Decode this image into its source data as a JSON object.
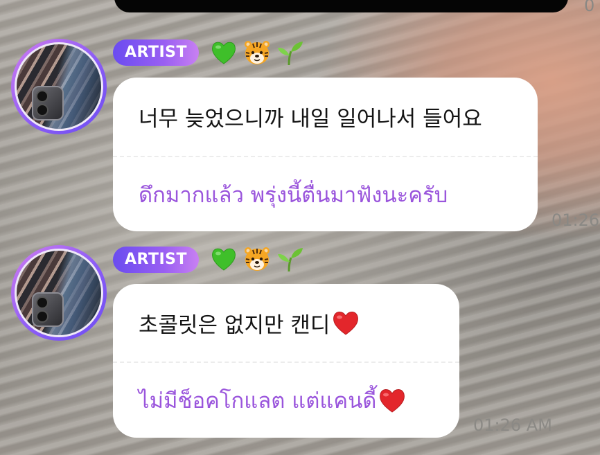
{
  "messages": [
    {
      "badge": "ARTIST",
      "reactions": [
        "green-heart",
        "tiger-face",
        "seedling"
      ],
      "original_text": "너무 늦었으니까 내일 일어나서 들어요",
      "translated_text": "ดึกมากแล้ว พรุ่งนี้ตื่นมาฟังนะครับ",
      "time": ""
    },
    {
      "badge": "ARTIST",
      "reactions": [
        "green-heart",
        "tiger-face",
        "seedling"
      ],
      "original_text": "초콜릿은 없지만 캔디",
      "translated_text": "ไม่มีช็อคโกแลต แต่แคนดี้",
      "trailing_emoji": "red-heart",
      "time": "01:26 AM"
    }
  ],
  "edge_times": {
    "top": "0",
    "middle": "01:26"
  },
  "colors": {
    "badge_gradient": [
      "#6a4cf0",
      "#c880f2"
    ],
    "translation_text": "#9a55dc",
    "bubble_bg": "#ffffff"
  }
}
